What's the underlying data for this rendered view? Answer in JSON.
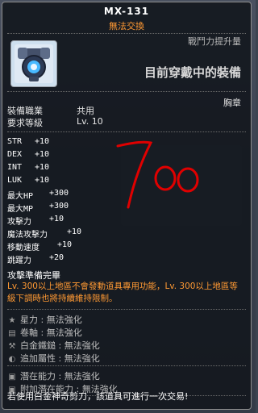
{
  "title": "MX-131",
  "trade_status": "無法交換",
  "top_note": "戰鬥力提升量",
  "equip_now": "目前穿戴中的裝備",
  "slot": "胸章",
  "job_label": "裝備職業",
  "job_value": "共用",
  "level_label": "要求等級",
  "level_value": "Lv. 10",
  "stats": [
    {
      "name": "STR",
      "value": "+10"
    },
    {
      "name": "DEX",
      "value": "+10"
    },
    {
      "name": "INT",
      "value": "+10"
    },
    {
      "name": "LUK",
      "value": "+10"
    },
    {
      "name": "最大HP",
      "value": "+300"
    },
    {
      "name": "最大MP",
      "value": "+300"
    },
    {
      "name": "攻擊力",
      "value": "+10"
    },
    {
      "name": "魔法攻擊力",
      "value": "+10"
    },
    {
      "name": "移動速度",
      "value": "+10"
    },
    {
      "name": "跳躍力",
      "value": "+20"
    }
  ],
  "preparation": "攻擊準備完畢",
  "orange_note": "Lv. 300以上地區不會發動道具專用功能，Lv. 300以上地區等級下調時也將持續維持限制。",
  "enhance": [
    {
      "icon": "star-icon",
      "label": "星力 : 無法強化"
    },
    {
      "icon": "scroll-icon",
      "label": "卷軸 : 無法強化"
    },
    {
      "icon": "hammer-icon",
      "label": "白金鐵鎚 : 無法強化"
    },
    {
      "icon": "flame-icon",
      "label": "追加屬性 : 無法強化"
    }
  ],
  "potential": [
    {
      "icon": "potential-icon",
      "label": "潛在能力 : 無法強化"
    },
    {
      "icon": "additional-potential-icon",
      "label": "附加潛在能力 : 無法強化"
    }
  ],
  "trade_note": "若使用白金神奇剪刀，該道具可進行一次交易!",
  "handwritten": "700",
  "colors": {
    "orange": "#ff9933",
    "ink_red": "#e00000"
  }
}
